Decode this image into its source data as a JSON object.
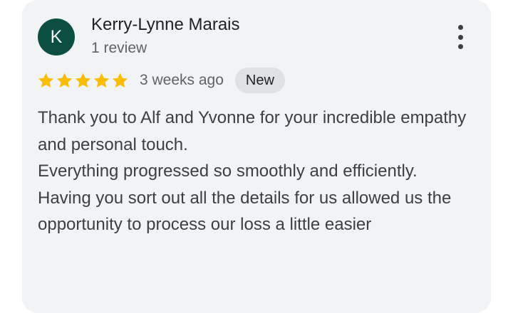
{
  "review": {
    "avatar_initial": "K",
    "avatar_color": "#0b4f43",
    "reviewer_name": "Kerry-Lynne Marais",
    "review_count": "1 review",
    "rating": 5,
    "rating_max": 5,
    "star_color": "#fbbc04",
    "time": "3 weeks ago",
    "badge": "New",
    "more_icon": "more-vert-icon",
    "paragraphs": [
      "Thank you to Alf and Yvonne for your incredible empathy and personal touch.",
      "Everything progressed so smoothly and efficiently.",
      "Having you sort out all the details for us allowed us the opportunity to process our loss a little easier"
    ]
  }
}
